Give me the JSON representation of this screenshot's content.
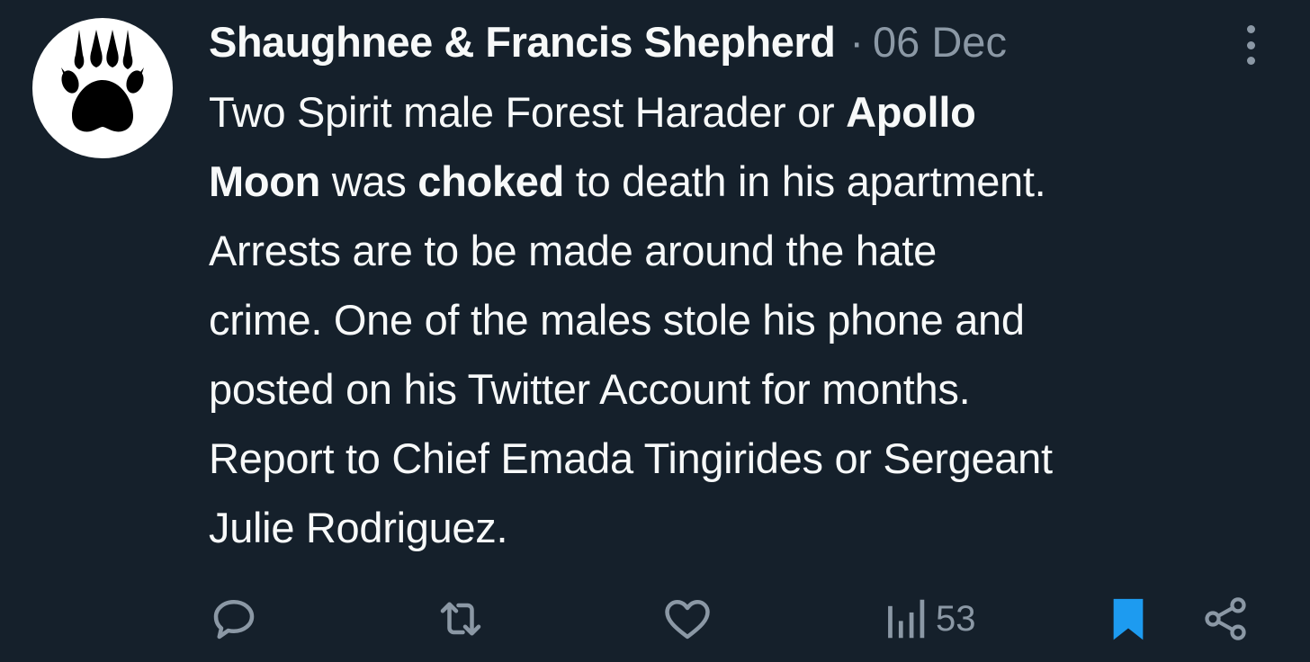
{
  "tweet": {
    "author": "Shaughnee & Francis Shepherd",
    "separator": "·",
    "date": "06 Dec",
    "avatar_icon": "paw-print-icon",
    "body_lines": [
      [
        {
          "t": "Two Spirit male Forest Harader or ",
          "b": false
        },
        {
          "t": "Apollo",
          "b": true
        }
      ],
      [
        {
          "t": "Moon",
          "b": true
        },
        {
          "t": " was ",
          "b": false
        },
        {
          "t": "choked",
          "b": true
        },
        {
          "t": " to death in his apartment.",
          "b": false
        }
      ],
      [
        {
          "t": "Arrests are to be made around the hate",
          "b": false
        }
      ],
      [
        {
          "t": "crime. One of the males stole his phone and",
          "b": false
        }
      ],
      [
        {
          "t": "posted on his Twitter Account for months.",
          "b": false
        }
      ],
      [
        {
          "t": "Report to Chief Emada Tingirides or Sergeant",
          "b": false
        }
      ],
      [
        {
          "t": "Julie Rodriguez.",
          "b": false
        }
      ]
    ]
  },
  "actions": {
    "reply_icon": "reply-icon",
    "retweet_icon": "retweet-icon",
    "like_icon": "heart-icon",
    "views_icon": "analytics-icon",
    "views_count": "53",
    "bookmark_icon": "bookmark-icon",
    "share_icon": "share-icon",
    "more_icon": "more-vertical-icon"
  },
  "colors": {
    "background": "#15202b",
    "primary_text": "#f7f9f9",
    "secondary_text": "#8b98a5",
    "bookmark_active": "#1d9bf0",
    "avatar_bg": "#ffffff"
  }
}
